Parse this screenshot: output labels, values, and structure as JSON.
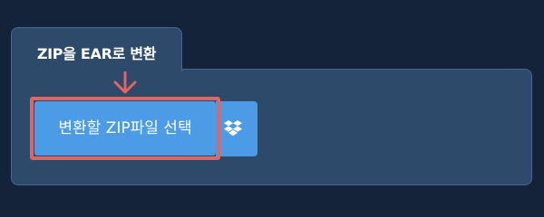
{
  "tab": {
    "title": "ZIP을 EAR로 변환"
  },
  "upload": {
    "select_button_label": "변환할 ZIP파일 선택",
    "dropbox_icon": "dropbox-icon"
  },
  "annotation": {
    "arrow_icon": "arrow-down-icon",
    "arrow_color": "#e06666",
    "highlight_color": "#e06666"
  },
  "colors": {
    "background": "#14233a",
    "panel": "#2d4a6b",
    "button": "#4c9be6",
    "button_text": "#ffffff"
  }
}
